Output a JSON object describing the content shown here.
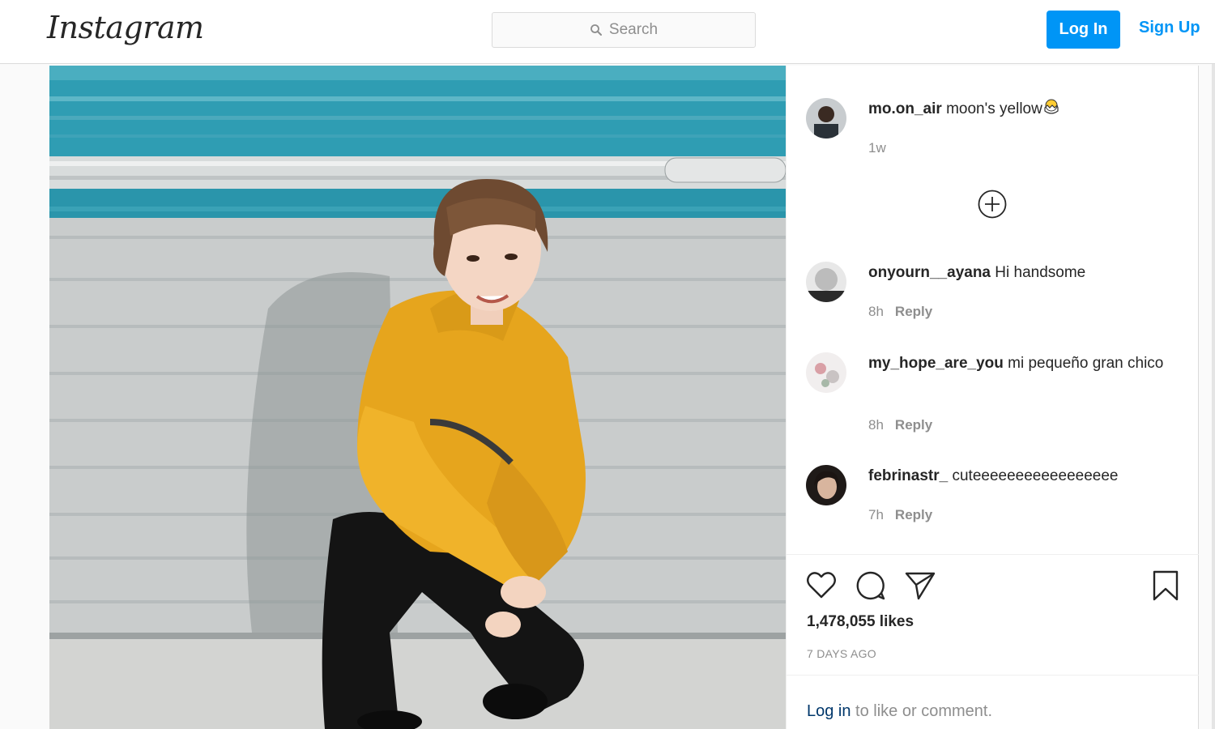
{
  "header": {
    "logo": "Instagram",
    "search_placeholder": "Search",
    "login_label": "Log In",
    "signup_label": "Sign Up"
  },
  "post": {
    "author": "mo.on_air",
    "caption": "moon's yellow",
    "caption_emoji": "hatching-chick-emoji",
    "posted": "1w"
  },
  "comments": [
    {
      "user": "onyourn__ayana",
      "text": "Hi handsome",
      "time": "8h",
      "reply_label": "Reply"
    },
    {
      "user": "my_hope_are_you",
      "text": "mi pequeño gran chico",
      "time": "8h",
      "reply_label": "Reply"
    },
    {
      "user": "febrinastr_",
      "text": "cuteeeeeeeeeeeeeeeee",
      "time": "7h",
      "reply_label": "Reply"
    }
  ],
  "stats": {
    "likes": "1,478,055 likes",
    "time_ago": "7 DAYS AGO"
  },
  "cta": {
    "link": "Log in",
    "text": " to like or comment."
  },
  "icons": [
    "search-icon",
    "load-more-icon",
    "like-icon",
    "comment-icon",
    "share-icon",
    "save-icon"
  ],
  "colors": {
    "accent": "#0095f6",
    "text": "#262626",
    "muted": "#8e8e8e",
    "hoodie": "#e6a51d",
    "wall_teal": "#2b9bb1"
  }
}
